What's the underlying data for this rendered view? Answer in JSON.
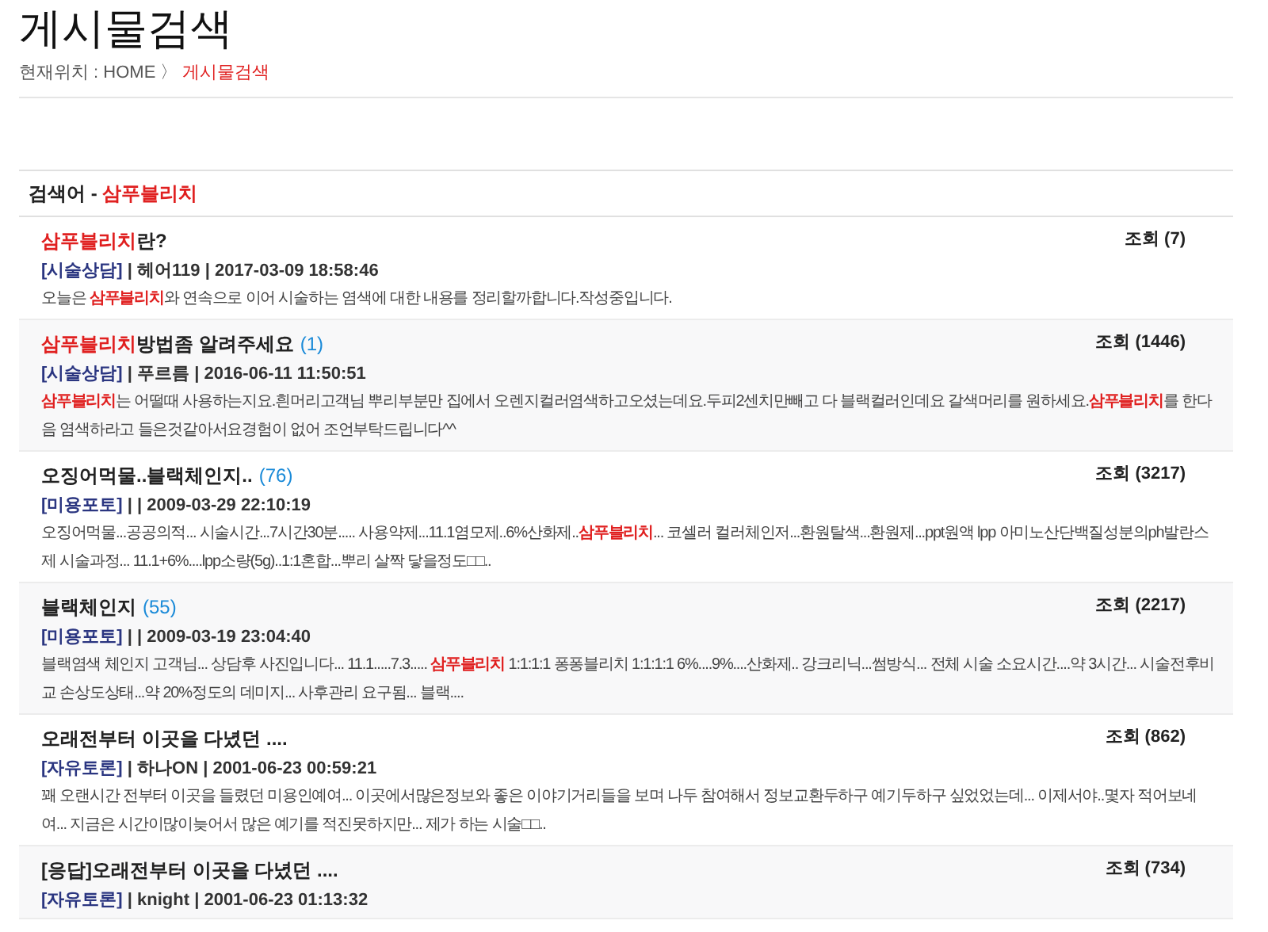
{
  "page_title": "게시물검색",
  "breadcrumb": {
    "label": "현재위치 : HOME",
    "separator": "〉",
    "current": "게시물검색"
  },
  "search_header": {
    "label": "검색어 - ",
    "keyword": "삼푸블리치"
  },
  "results": [
    {
      "title": "**삼푸블리치**란?",
      "views": "조회 (7)",
      "category": "[시술상담]",
      "meta": " | 헤어119 | 2017-03-09 18:58:46",
      "excerpt": "오늘은 **삼푸블리치**와  연속으로 이어 시술하는 염색에 대한 내용를 정리할까합니다.작성중입니다."
    },
    {
      "title": "**삼푸블리치**방법좀 알려주세요",
      "comments": "(1)",
      "views": "조회 (1446)",
      "category": "[시술상담]",
      "meta": " | 푸르름 | 2016-06-11 11:50:51",
      "excerpt": "**삼푸블리치**는 어떨때 사용하는지요.흰머리고객님 뿌리부분만 집에서 오렌지컬러염색하고오셨는데요.두피2센치만빼고 다 블랙컬러인데요 갈색머리를 원하세요.**삼푸블리치**를 한다음 염색하라고 들은것같아서요경험이 없어 조언부탁드립니다^^"
    },
    {
      "title": "오징어먹물..블랙체인지..",
      "comments": "(76)",
      "views": "조회 (3217)",
      "category": "[미용포토]",
      "meta": " | | 2009-03-29 22:10:19",
      "excerpt": "오징어먹물...공공의적... 시술시간...7시간30분..... 사용약제...11.1염모제..6%산화제..**삼푸블리치**... 코셀러 컬러체인저...환원탈색...환원제...ppt원액 lpp 아미노산단백질성분의ph발란스제 시술과정... 11.1+6%....lpp소량(5g)..1:1혼합...뿌리 살짝 닿을정도□□.."
    },
    {
      "title": "블랙체인지",
      "comments": "(55)",
      "views": "조회 (2217)",
      "category": "[미용포토]",
      "meta": " | | 2009-03-19 23:04:40",
      "excerpt": "블랙염색 체인지 고객님... 상담후 사진입니다... 11.1.....7.3..... **삼푸블리치** 1:1:1:1 퐁퐁블리치 1:1:1:1 6%....9%....산화제.. 강크리닉...썸방식... 전체 시술 소요시간....약 3시간... 시술전후비교 손상도상태...약 20%정도의 데미지... 사후관리 요구됨... 블랙...."
    },
    {
      "title": "오래전부터 이곳을 다녔던 ....",
      "views": "조회 (862)",
      "category": "[자유토론]",
      "meta": " | 하나ON | 2001-06-23 00:59:21",
      "excerpt": "꽤 오랜시간 전부터 이곳을 들렸던 미용인예여... 이곳에서많은정보와 좋은 이야기거리들을 보며 나두 참여해서 정보교환두하구 예기두하구 싶었었는데... 이제서야..몇자 적어보네여... 지금은 시간이많이늦어서 많은 예기를 적진못하지만... 제가 하는 시술□□.."
    },
    {
      "title": "[응답]오래전부터 이곳을 다녔던 ....",
      "views": "조회 (734)",
      "category": "[자유토론]",
      "meta": " | knight | 2001-06-23 01:13:32"
    }
  ]
}
